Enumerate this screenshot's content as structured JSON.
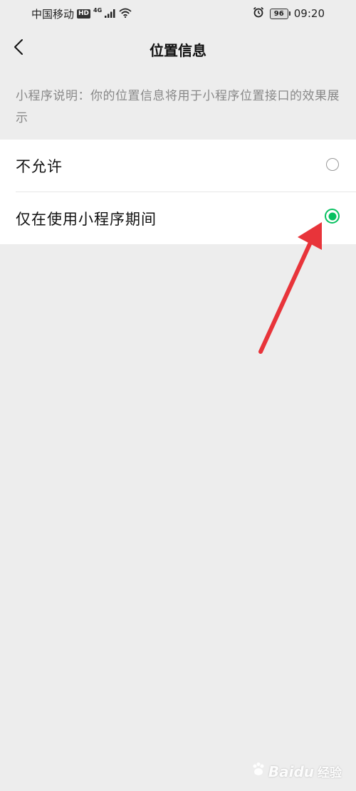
{
  "status_bar": {
    "carrier": "中国移动",
    "hd_badge": "HD",
    "network_type": "4G",
    "battery_level": "96",
    "time": "09:20",
    "icons": [
      "signal-icon",
      "wifi-icon",
      "alarm-icon",
      "battery-icon"
    ]
  },
  "nav_bar": {
    "back_icon": "chevron-left-icon",
    "title": "位置信息"
  },
  "description": "小程序说明：你的位置信息将用于小程序位置接口的效果展示",
  "options": [
    {
      "label": "不允许",
      "selected": false
    },
    {
      "label": "仅在使用小程序期间",
      "selected": true
    }
  ],
  "colors": {
    "accent": "#07c160",
    "background": "#ededed",
    "annotation_arrow": "#e8343a"
  },
  "watermark": {
    "brand": "Baidu",
    "sub": "经验"
  }
}
